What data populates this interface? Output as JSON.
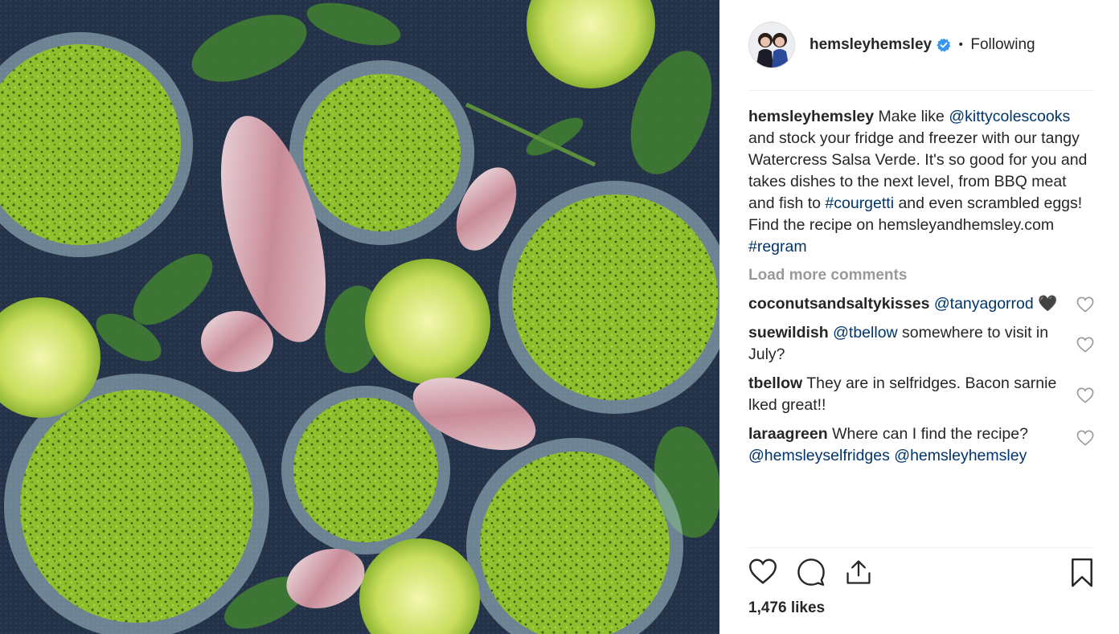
{
  "post": {
    "username": "hemsleyhemsley",
    "follow_state": "Following",
    "separator": "•"
  },
  "caption": {
    "username": "hemsleyhemsley",
    "text1": " Make like ",
    "mention1": "@kittycolescooks",
    "text2": " and stock your fridge and freezer with our tangy Watercress Salsa Verde. It's so good for you and takes dishes to the next level, from BBQ meat and fish to ",
    "hashtag1": "#courgetti",
    "text3": " and even scrambled eggs! Find the recipe on hemsleyandhemsley.com ",
    "hashtag2": "#regram"
  },
  "load_more": "Load more comments",
  "comments": [
    {
      "username": "coconutsandsaltykisses",
      "mention": "@tanyagorrod",
      "text": " 🖤"
    },
    {
      "username": "suewildish",
      "mention": "@tbellow",
      "text": " somewhere to visit in July?"
    },
    {
      "username": "tbellow",
      "text": " They are in selfridges. Bacon sarnie lked great!!"
    },
    {
      "username": "laraagreen",
      "text": " Where can I find the recipe? ",
      "mention": "@hemsleyselfridges",
      "mention2": "@hemsleyhemsley"
    }
  ],
  "likes": "1,476 likes",
  "icons": {
    "verified": "verified-badge-icon",
    "like": "heart-icon",
    "comment": "comment-bubble-icon",
    "share": "share-icon",
    "save": "bookmark-icon"
  },
  "colors": {
    "link": "#003569",
    "verified": "#3897f0",
    "muted": "#999999",
    "text": "#262626"
  }
}
